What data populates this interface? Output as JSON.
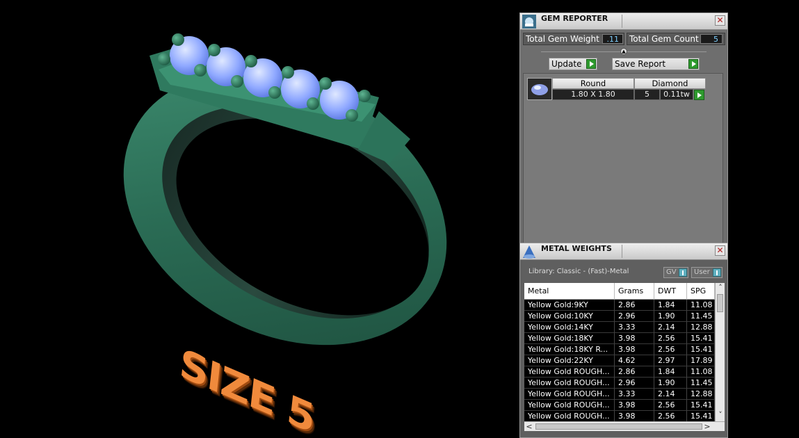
{
  "viewport": {
    "size_label": "SIZE 5"
  },
  "gem_reporter": {
    "title": "GEM REPORTER",
    "total_weight_label": "Total Gem Weight",
    "total_weight_value": ".11",
    "total_count_label": "Total Gem Count",
    "total_count_value": "5",
    "update_label": "Update",
    "save_report_label": "Save Report",
    "gem": {
      "shape": "Round",
      "material": "Diamond",
      "size": "1.80 X 1.80",
      "count": "5",
      "weight": "0.11tw"
    }
  },
  "metal_weights": {
    "title": "METAL WEIGHTS",
    "library": "Library: Classic - (Fast)-Metal",
    "gv_label": "GV",
    "user_label": "User",
    "columns": [
      "Metal",
      "Grams",
      "DWT",
      "SPG"
    ],
    "rows": [
      [
        "Yellow Gold:9KY",
        "2.86",
        "1.84",
        "11.08"
      ],
      [
        "Yellow Gold:10KY",
        "2.96",
        "1.90",
        "11.45"
      ],
      [
        "Yellow Gold:14KY",
        "3.33",
        "2.14",
        "12.88"
      ],
      [
        "Yellow Gold:18KY",
        "3.98",
        "2.56",
        "15.41"
      ],
      [
        "Yellow Gold:18KY R...",
        "3.98",
        "2.56",
        "15.41"
      ],
      [
        "Yellow Gold:22KY",
        "4.62",
        "2.97",
        "17.89"
      ],
      [
        "Yellow Gold ROUGH...",
        "2.86",
        "1.84",
        "11.08"
      ],
      [
        "Yellow Gold ROUGH...",
        "2.96",
        "1.90",
        "11.45"
      ],
      [
        "Yellow Gold ROUGH...",
        "3.33",
        "2.14",
        "12.88"
      ],
      [
        "Yellow Gold ROUGH...",
        "3.98",
        "2.56",
        "15.41"
      ],
      [
        "Yellow Gold ROUGH...",
        "3.98",
        "2.56",
        "15.41"
      ]
    ]
  }
}
